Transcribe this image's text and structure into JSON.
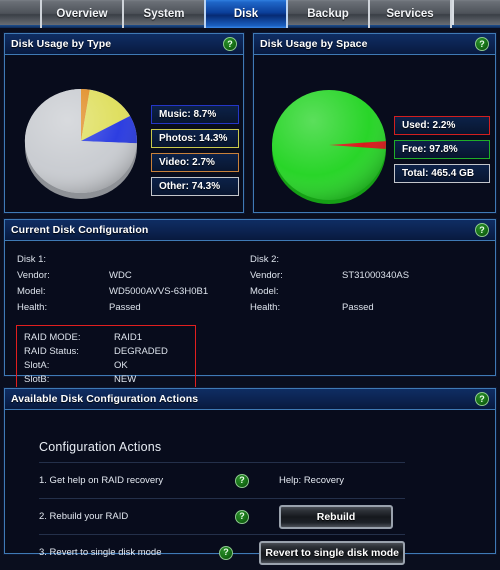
{
  "nav": {
    "tabs": [
      {
        "label": "Overview",
        "active": false
      },
      {
        "label": "System",
        "active": false
      },
      {
        "label": "Disk",
        "active": true
      },
      {
        "label": "Backup",
        "active": false
      },
      {
        "label": "Services",
        "active": false
      }
    ]
  },
  "help_icon_glyph": "?",
  "panels": {
    "usage_by_type": {
      "title": "Disk Usage by Type",
      "help_icon": "help-icon",
      "legend": [
        {
          "label": "Music: 8.7%",
          "border": "#2436c8"
        },
        {
          "label": "Photos: 14.3%",
          "border": "#c9c94a"
        },
        {
          "label": "Video: 2.7%",
          "border": "#c9813a"
        },
        {
          "label": "Other: 74.3%",
          "border": "#c3c6cb"
        }
      ]
    },
    "usage_by_space": {
      "title": "Disk Usage by Space",
      "help_icon": "help-icon",
      "legend": [
        {
          "label": "Used: 2.2%",
          "border": "#d21f1f"
        },
        {
          "label": "Free: 97.8%",
          "border": "#1fae28"
        },
        {
          "label": "Total: 465.4 GB",
          "border": "#c3c6cb"
        }
      ]
    },
    "current_config": {
      "title": "Current Disk Configuration",
      "help_icon": "help-icon",
      "disk1": {
        "heading": "Disk 1:",
        "rows": [
          {
            "label": "Vendor:",
            "value": "WDC"
          },
          {
            "label": "Model:",
            "value": "WD5000AVVS-63H0B1"
          },
          {
            "label": "Health:",
            "value": "Passed"
          }
        ]
      },
      "disk2": {
        "heading": "Disk 2:",
        "rows": [
          {
            "label": "Vendor:",
            "value": "ST31000340AS"
          },
          {
            "label": "Model:",
            "value": ""
          },
          {
            "label": "Health:",
            "value": "Passed"
          }
        ]
      },
      "raid": {
        "highlight_color": "#e11f1f",
        "rows": [
          {
            "label": "RAID MODE:",
            "value": "RAID1"
          },
          {
            "label": "RAID Status:",
            "value": "DEGRADED"
          },
          {
            "label": "SlotA:",
            "value": "OK"
          },
          {
            "label": "SlotB:",
            "value": "NEW"
          }
        ]
      }
    },
    "available_actions": {
      "title": "Available Disk Configuration Actions",
      "help_icon": "help-icon",
      "section_title": "Configuration Actions",
      "rows": [
        {
          "label": "1. Get help on RAID recovery",
          "help_icon": "help-icon",
          "kind": "text",
          "target": "Help: Recovery"
        },
        {
          "label": "2. Rebuild your RAID",
          "help_icon": "help-icon",
          "kind": "button",
          "target": "Rebuild"
        },
        {
          "label": "3. Revert to single disk mode",
          "help_icon": "help-icon",
          "kind": "button",
          "target": "Revert to single disk mode"
        }
      ]
    }
  },
  "chart_data": [
    {
      "type": "pie",
      "title": "Disk Usage by Type",
      "categories": [
        "Video",
        "Photos",
        "Music",
        "Other"
      ],
      "values": [
        2.7,
        14.3,
        8.7,
        74.3
      ],
      "unit": "%",
      "colors": [
        "#e08a1e",
        "#dede5a",
        "#2436e0",
        "#c8cbd0"
      ],
      "legend_position": "right",
      "start_angle_deg": 0,
      "direction": "clockwise"
    },
    {
      "type": "pie",
      "title": "Disk Usage by Space",
      "categories": [
        "Used",
        "Free"
      ],
      "values": [
        2.2,
        97.8
      ],
      "unit": "%",
      "total_label": "Total: 465.4 GB",
      "total_gb": 465.4,
      "colors": [
        "#d81414",
        "#22d422"
      ],
      "legend_position": "right",
      "start_angle_deg": 90,
      "direction": "clockwise"
    }
  ]
}
